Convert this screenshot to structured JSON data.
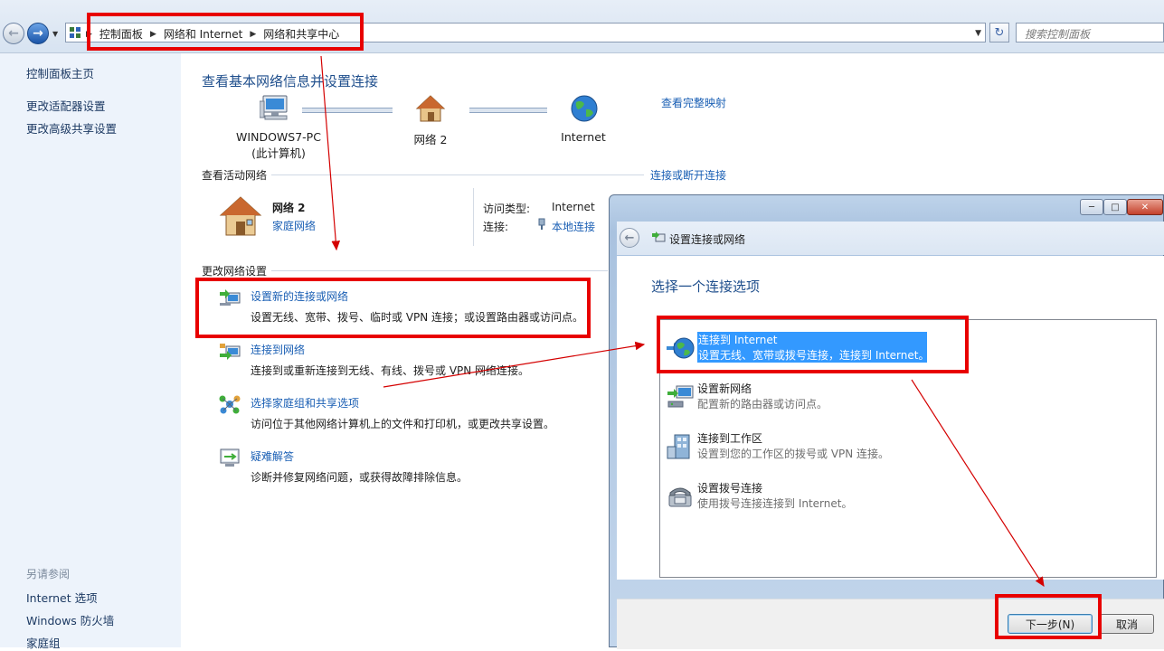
{
  "address_bar": {
    "breadcrumbs": [
      "控制面板",
      "网络和 Internet",
      "网络和共享中心"
    ],
    "search_placeholder": "搜索控制面板"
  },
  "sidebar": {
    "top_links": [
      "控制面板主页",
      "更改适配器设置",
      "更改高级共享设置"
    ],
    "see_also_label": "另请参阅",
    "see_also_links": [
      "Internet 选项",
      "Windows 防火墙",
      "家庭组"
    ]
  },
  "main": {
    "title": "查看基本网络信息并设置连接",
    "view_full_map": "查看完整映射",
    "map_nodes": [
      {
        "label": "WINDOWS7-PC",
        "sublabel": "(此计算机)"
      },
      {
        "label": "网络  2"
      },
      {
        "label": "Internet"
      }
    ],
    "active_networks_label": "查看活动网络",
    "connect_disconnect": "连接或断开连接",
    "network": {
      "name": "网络  2",
      "type": "家庭网络",
      "access_type_label": "访问类型:",
      "access_type_value": "Internet",
      "connections_label": "连接:",
      "connections_value": "本地连接"
    },
    "change_settings_label": "更改网络设置",
    "tasks": [
      {
        "title": "设置新的连接或网络",
        "desc": "设置无线、宽带、拨号、临时或 VPN 连接；或设置路由器或访问点。",
        "icon": "setup-connection-icon"
      },
      {
        "title": "连接到网络",
        "desc": "连接到或重新连接到无线、有线、拨号或 VPN 网络连接。",
        "icon": "connect-network-icon"
      },
      {
        "title": "选择家庭组和共享选项",
        "desc": "访问位于其他网络计算机上的文件和打印机，或更改共享设置。",
        "icon": "homegroup-icon"
      },
      {
        "title": "疑难解答",
        "desc": "诊断并修复网络问题，或获得故障排除信息。",
        "icon": "troubleshoot-icon"
      }
    ]
  },
  "dialog": {
    "title": "设置连接或网络",
    "prompt": "选择一个连接选项",
    "options": [
      {
        "title": "连接到 Internet",
        "desc": "设置无线、宽带或拨号连接，连接到 Internet。",
        "icon": "globe-icon",
        "selected": true
      },
      {
        "title": "设置新网络",
        "desc": "配置新的路由器或访问点。",
        "icon": "router-icon"
      },
      {
        "title": "连接到工作区",
        "desc": "设置到您的工作区的拨号或 VPN 连接。",
        "icon": "workplace-icon"
      },
      {
        "title": "设置拨号连接",
        "desc": "使用拨号连接连接到 Internet。",
        "icon": "dialup-phone-icon"
      }
    ],
    "next_button": "下一步(N)",
    "cancel_button": "取消"
  },
  "colors": {
    "annotation_red": "#e80000",
    "link_blue": "#1a5fb4",
    "title_blue": "#1e4e8c",
    "selection": "#3399ff"
  }
}
